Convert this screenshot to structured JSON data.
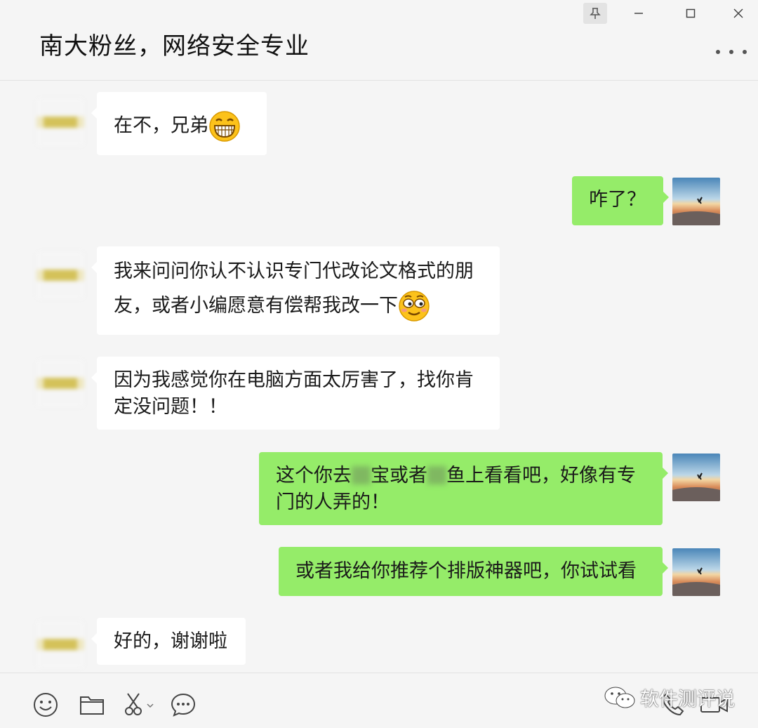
{
  "chat": {
    "title": "南大粉丝，网络安全专业"
  },
  "messages": [
    {
      "text": "在不，兄弟",
      "emoji": "grin-emoji"
    },
    {
      "text": "咋了？"
    },
    {
      "line1": "我来问问你认不认识专门代改论文格式的朋",
      "line2": "友，或者小编愿意有偿帮我改一下",
      "emoji": "wink-emoji"
    },
    {
      "line1": "因为我感觉你在电脑方面太厉害了，找你肯",
      "line2": "定没问题！！"
    },
    {
      "line1a": "这个你去",
      "line1b": "宝或者",
      "line1c": "鱼上看看吧，好像有专",
      "line2": "门的人弄的！"
    },
    {
      "text": "或者我给你推荐个排版神器吧，你试试看"
    },
    {
      "text": "好的，谢谢啦"
    }
  ],
  "toolbar": {
    "icons": [
      "emoji-icon",
      "folder-icon",
      "scissors-icon",
      "chat-bubble-icon",
      "phone-icon",
      "video-icon"
    ]
  },
  "watermark": {
    "text": "软件测评说"
  },
  "colors": {
    "outgoing": "#95ec69",
    "incoming": "#ffffff",
    "background": "#f5f5f5"
  }
}
